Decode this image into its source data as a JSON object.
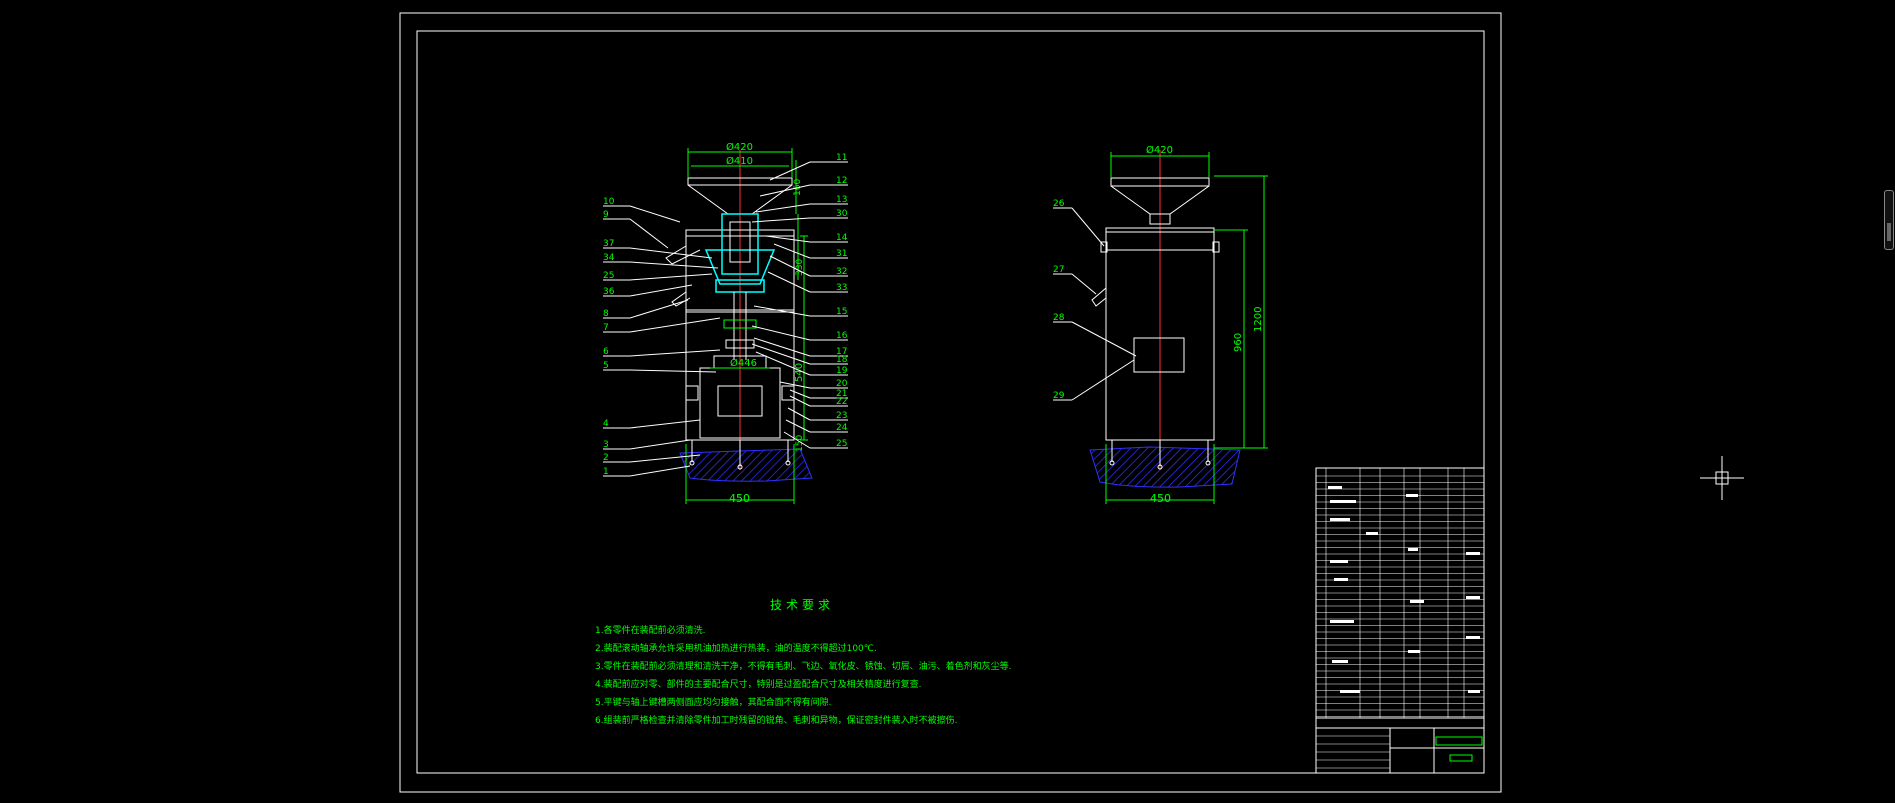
{
  "front_view": {
    "dim_top_outer": "Ø420",
    "dim_top_inner": "Ø410",
    "dim_motor": "Ø446",
    "dim_base": "450",
    "dim_side_main": "540",
    "dim_side_top": "160",
    "dim_side_mid": "330",
    "dim_side_bottom": "150",
    "callouts_left": [
      "10",
      "9",
      "37",
      "34",
      "25",
      "36",
      "8",
      "7",
      "6",
      "5",
      "4",
      "3",
      "2",
      "1"
    ],
    "callouts_right": [
      "11",
      "12",
      "13",
      "30",
      "14",
      "31",
      "32",
      "33",
      "15",
      "16",
      "17",
      "18",
      "19",
      "20",
      "21",
      "22",
      "23",
      "24",
      "25"
    ]
  },
  "side_view": {
    "dim_top": "Ø420",
    "dim_base": "450",
    "dim_height_total": "1200",
    "dim_height_body": "960",
    "callouts": [
      "26",
      "27",
      "28",
      "29"
    ]
  },
  "tech_requirements": {
    "title": "技术要求",
    "items": [
      "1.各零件在装配前必须清洗.",
      "2.装配滚动轴承允许采用机油加热进行热装，油的温度不得超过100℃.",
      "3.零件在装配前必须清理和清洗干净，不得有毛刺、飞边、氧化皮、锈蚀、切屑、油污、着色剂和灰尘等.",
      "4.装配前应对零、部件的主要配合尺寸，特别是过盈配合尺寸及相关精度进行复查.",
      "5.平键与轴上键槽两侧面应均匀接触，其配合面不得有间隙.",
      "6.组装前严格检查并清除零件加工时残留的锐角、毛刺和异物，保证密封件装入时不被擦伤."
    ]
  },
  "colors": {
    "background": "#000000",
    "frame": "#ffffff",
    "dimension": "#00ff00",
    "center_line": "#ff3030",
    "accent": "#00ffff",
    "ground": "#3030ff"
  }
}
